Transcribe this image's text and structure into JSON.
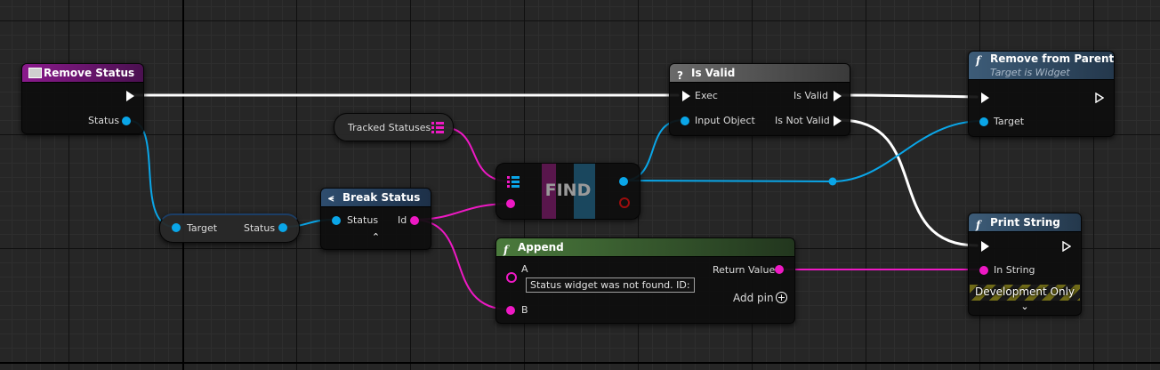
{
  "nodes": {
    "remove_status": {
      "title": "Remove Status",
      "pin_status": "Status"
    },
    "tracked_statuses": {
      "label": "Tracked Statuses"
    },
    "target_status": {
      "pin_target": "Target",
      "pin_status": "Status"
    },
    "break_status": {
      "title": "Break Status",
      "pin_status": "Status",
      "pin_id": "Id"
    },
    "find": {
      "label": "FIND"
    },
    "append": {
      "title": "Append",
      "pin_a": "A",
      "a_default": "Status widget was not found. ID:",
      "pin_b": "B",
      "pin_return": "Return Value",
      "add_pin": "Add pin"
    },
    "is_valid": {
      "title": "Is Valid",
      "pin_exec": "Exec",
      "pin_input": "Input Object",
      "out_valid": "Is Valid",
      "out_not_valid": "Is Not Valid"
    },
    "remove_from_parent": {
      "title": "Remove from Parent",
      "subtitle": "Target is Widget",
      "pin_target": "Target"
    },
    "print_string": {
      "title": "Print String",
      "pin_in": "In String",
      "dev_only": "Development Only"
    }
  },
  "icons": {
    "event": "event-icon",
    "function": "function-icon",
    "macro": "question-icon",
    "break": "break-struct-icon",
    "array": "array-icon",
    "add": "add-pin-icon",
    "chevron": "chevron-icon"
  },
  "colors": {
    "object_pin": "#0aa6e8",
    "string_pin": "#ee19c4",
    "exec_pin": "#ffffff",
    "event_header": "#8a1a8c",
    "function_header": "#3d5c78",
    "append_header": "#4a7a3c",
    "macro_header": "#5e5e5e"
  }
}
